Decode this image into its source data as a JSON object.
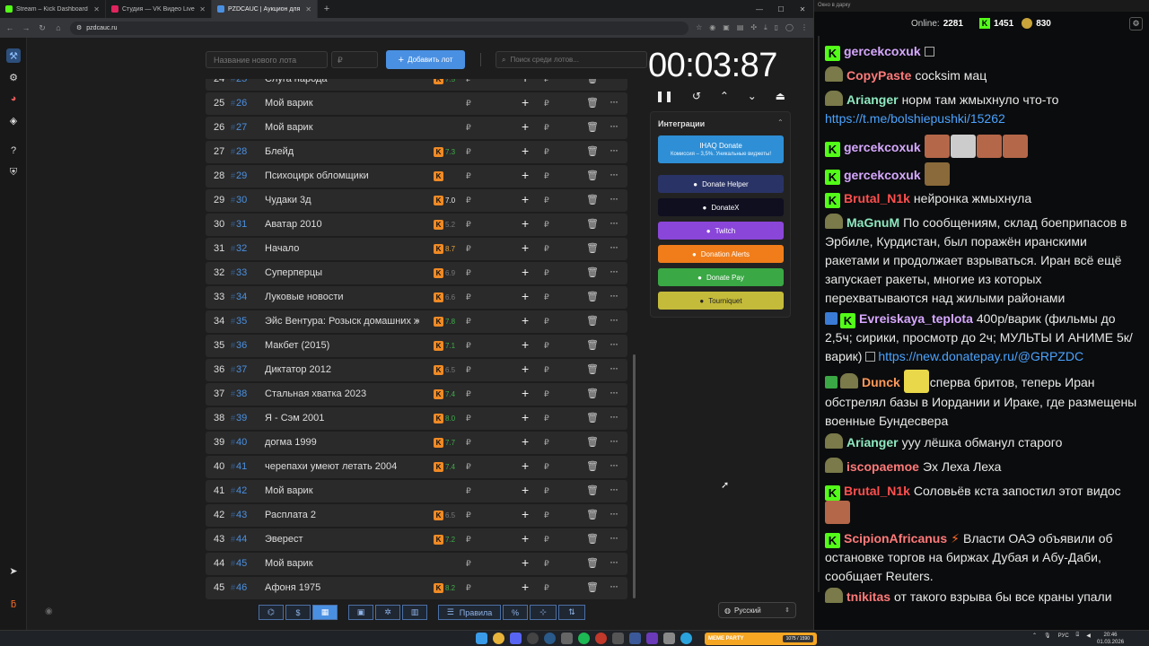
{
  "browser": {
    "tabs": [
      {
        "title": "Stream – Kick Dashboard",
        "color": "#53fc18",
        "active": false
      },
      {
        "title": "Студия — VK Видео Live",
        "color": "#e0245e",
        "active": false
      },
      {
        "title": "PZDCAUC | Аукцион для стри",
        "color": "#4a90e2",
        "active": true
      }
    ],
    "url": "pzdcauc.ru"
  },
  "toolbar": {
    "lot_name_placeholder": "Название нового лота",
    "price_placeholder": "₽",
    "add_label": "Добавить лот",
    "search_placeholder": "Поиск среди лотов..."
  },
  "lots": [
    {
      "idx": "24",
      "order": "25",
      "name": "Слуга народа",
      "kp": "7.5",
      "kp_color": "#3fae4a"
    },
    {
      "idx": "25",
      "order": "26",
      "name": "Мой варик",
      "kp": "",
      "kp_color": ""
    },
    {
      "idx": "26",
      "order": "27",
      "name": "Мой варик",
      "kp": "",
      "kp_color": ""
    },
    {
      "idx": "27",
      "order": "28",
      "name": "Блейд",
      "kp": "7.3",
      "kp_color": "#3fae4a"
    },
    {
      "idx": "28",
      "order": "29",
      "name": "Психоцирк обломщики",
      "kp": "",
      "kp_color": "#aaa"
    },
    {
      "idx": "29",
      "order": "30",
      "name": "Чудаки 3д",
      "kp": "7.0",
      "kp_color": "#eee"
    },
    {
      "idx": "30",
      "order": "31",
      "name": "Аватар 2010",
      "kp": "5.2",
      "kp_color": "#777"
    },
    {
      "idx": "31",
      "order": "32",
      "name": "Начало",
      "kp": "8.7",
      "kp_color": "#e8a23a"
    },
    {
      "idx": "32",
      "order": "33",
      "name": "Суперперцы",
      "kp": "6.9",
      "kp_color": "#777"
    },
    {
      "idx": "33",
      "order": "34",
      "name": "Луковые новости",
      "kp": "6.6",
      "kp_color": "#777"
    },
    {
      "idx": "34",
      "order": "35",
      "name": "Эйс Вентура: Розыск домашних животных",
      "kp": "7.8",
      "kp_color": "#3fae4a"
    },
    {
      "idx": "35",
      "order": "36",
      "name": "Макбет (2015)",
      "kp": "7.1",
      "kp_color": "#3fae4a"
    },
    {
      "idx": "36",
      "order": "37",
      "name": "Диктатор 2012",
      "kp": "6.5",
      "kp_color": "#777"
    },
    {
      "idx": "37",
      "order": "38",
      "name": "Стальная хватка 2023",
      "kp": "7.4",
      "kp_color": "#3fae4a"
    },
    {
      "idx": "38",
      "order": "39",
      "name": "Я - Сэм 2001",
      "kp": "8.0",
      "kp_color": "#3fae4a"
    },
    {
      "idx": "39",
      "order": "40",
      "name": "догма 1999",
      "kp": "7.7",
      "kp_color": "#3fae4a"
    },
    {
      "idx": "40",
      "order": "41",
      "name": "черепахи умеют летать 2004",
      "kp": "7.4",
      "kp_color": "#3fae4a"
    },
    {
      "idx": "41",
      "order": "42",
      "name": "Мой варик",
      "kp": "",
      "kp_color": ""
    },
    {
      "idx": "42",
      "order": "43",
      "name": "Расплата 2",
      "kp": "6.5",
      "kp_color": "#777"
    },
    {
      "idx": "43",
      "order": "44",
      "name": "Эверест",
      "kp": "7.2",
      "kp_color": "#3fae4a"
    },
    {
      "idx": "44",
      "order": "45",
      "name": "Мой варик",
      "kp": "",
      "kp_color": ""
    },
    {
      "idx": "45",
      "order": "46",
      "name": "Афоня 1975",
      "kp": "8.2",
      "kp_color": "#3fae4a"
    }
  ],
  "currency": "₽",
  "timer": "00:03:87",
  "integrations": {
    "title": "Интеграции",
    "items": [
      {
        "label": "IHAQ Donate",
        "sub": "Комиссия – 3,5%. Уникальные виджеты!",
        "color": "#2e8fd6"
      },
      {
        "label": "Donate Helper",
        "color": "#2a3366"
      },
      {
        "label": "DonateX",
        "color": "#0f0f20"
      },
      {
        "label": "Twitch",
        "color": "#8a46d9"
      },
      {
        "label": "Donation Alerts",
        "color": "#f07d1a"
      },
      {
        "label": "Donate Pay",
        "color": "#3aa845"
      },
      {
        "label": "Tourniquet",
        "color": "#c5bb3a"
      }
    ]
  },
  "bottom": {
    "rules_label": "Правила",
    "language": "Русский"
  },
  "chat": {
    "window_title": "Окно в дарку",
    "online_label": "Online:",
    "online": "2281",
    "kick_count": "1451",
    "gold_count": "830",
    "messages": [
      {
        "user": "gercekcoxuk",
        "color": "#d6a8ff",
        "badge": "k",
        "text": ""
      },
      {
        "user": "CopyPaste",
        "color": "#ff7a7a",
        "badge": "av",
        "text": "cocksim мац"
      },
      {
        "user": "Arianger",
        "color": "#8ee8c0",
        "badge": "av",
        "text": "норм там жмыхнуло что-то"
      },
      {
        "user": "",
        "color": "",
        "badge": "",
        "text": "",
        "link": "https://t.me/bolshiepushki/15262"
      },
      {
        "user": "gercekcoxuk",
        "color": "#d6a8ff",
        "badge": "k",
        "text": ""
      },
      {
        "user": "gercekcoxuk",
        "color": "#d6a8ff",
        "badge": "k",
        "text": ""
      },
      {
        "user": "Brutal_N1k",
        "color": "#ff4f4f",
        "badge": "k",
        "text": "нейронка жмыхнула"
      },
      {
        "user": "MaGnuM",
        "color": "#8ee8c0",
        "badge": "av",
        "text": "По сообщениям, склад боеприпасов в Эрбиле, Курдистан, был поражён иранскими ракетами и продолжает взрываться. Иран всё ещё запускает ракеты, многие из которых перехватываются над жилыми районами"
      },
      {
        "user": "Evreiskaya_teplota",
        "color": "#d6a8ff",
        "badge": "k",
        "text": "400р/варик (фильмы до 2,5ч; сирики, просмотр до 2ч; МУЛЬТЫ И АНИМЕ 5к/варик)",
        "link": "https://new.donatepay.ru/@GRPZDC"
      },
      {
        "user": "Dunck",
        "color": "#ff9a5a",
        "badge": "av",
        "text": "сперва бритов, теперь Иран обстрелял базы в Иордании и Ираке, где размещены военные Бундесвера"
      },
      {
        "user": "Arianger",
        "color": "#8ee8c0",
        "badge": "av",
        "text": "ууу лёшка обманул старого"
      },
      {
        "user": "iscopaemoe",
        "color": "#ff7a7a",
        "badge": "av",
        "text": "Эх Леха Леха"
      },
      {
        "user": "Brutal_N1k",
        "color": "#ff4f4f",
        "badge": "k",
        "text": "Соловьёв кста запостил этот видос"
      },
      {
        "user": "ScipionAfricanus",
        "color": "#ff7a7a",
        "badge": "k",
        "text": "Власти ОАЭ объявили об остановке торгов на биржах Дубая и Абу-Даби, сообщает Reuters."
      },
      {
        "user": "tnikitas",
        "color": "#ff7a7a",
        "badge": "av",
        "text": "от такого взрыва бы все краны упали"
      }
    ]
  },
  "taskbar": {
    "meme_label": "MEME PARTY",
    "meme_count": "1075 / 1590",
    "lang": "РУС",
    "time": "20:46",
    "date": "01.03.2026"
  }
}
